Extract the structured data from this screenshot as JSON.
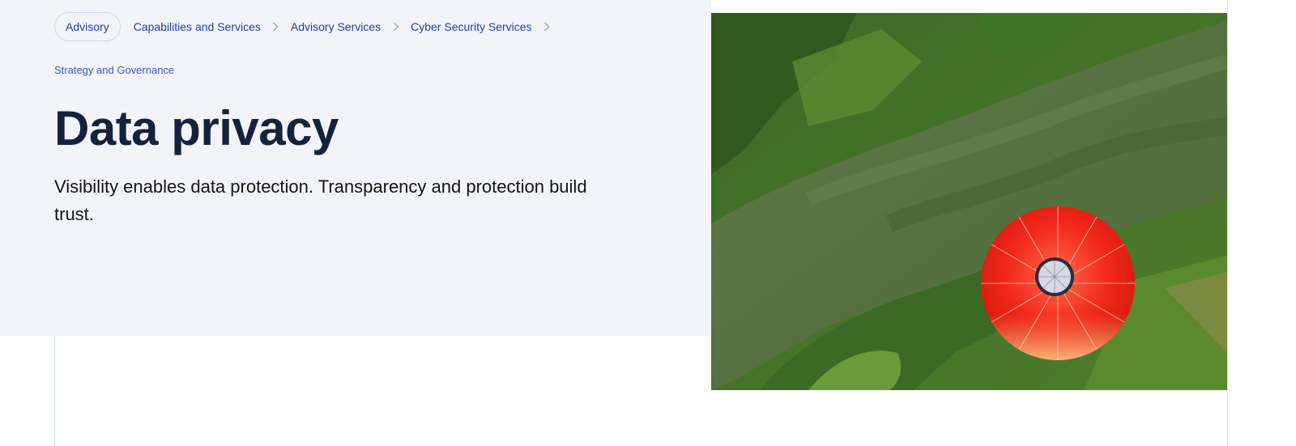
{
  "breadcrumb": {
    "items": [
      {
        "label": "Advisory"
      },
      {
        "label": "Capabilities and Services"
      },
      {
        "label": "Advisory Services"
      },
      {
        "label": "Cyber Security Services"
      }
    ],
    "current": "Strategy and Governance"
  },
  "hero": {
    "title": "Data privacy",
    "subtitle": "Visibility enables data protection. Transparency and protection build trust.",
    "image_icon": "hot-air-balloon-over-river-photo"
  },
  "colors": {
    "accent": "#1f3bb8",
    "hero_bg": "#f3f4f9",
    "title": "#14223d"
  }
}
